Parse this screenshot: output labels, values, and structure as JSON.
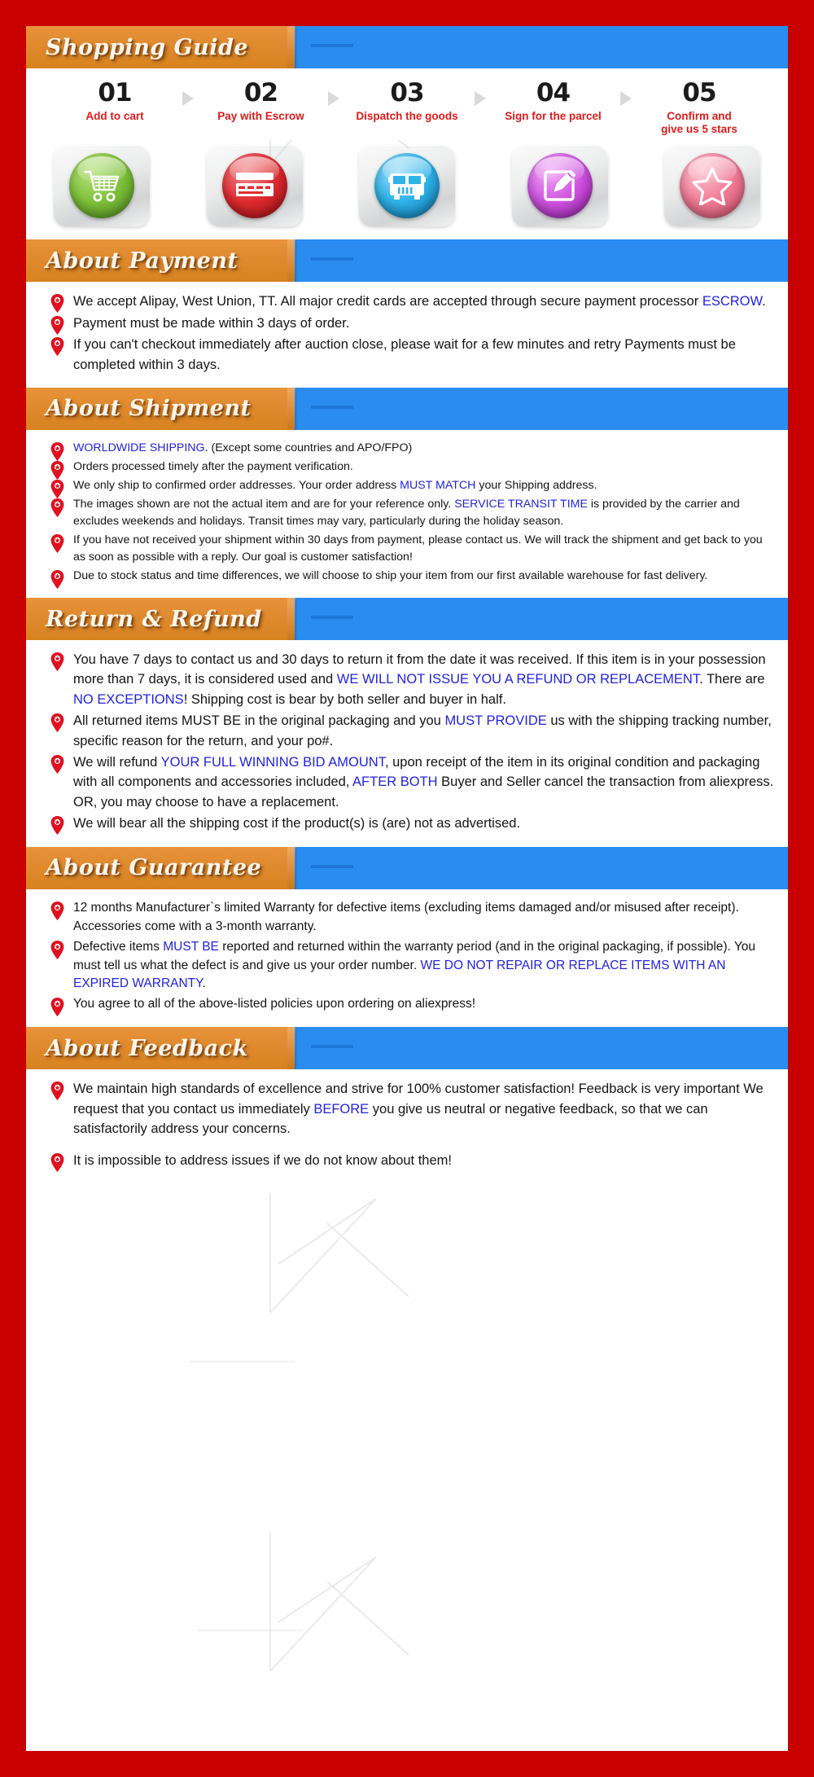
{
  "page": {
    "border_color": "#c80000",
    "accent_orange": "#df8a26",
    "accent_blue": "#2b8cf0",
    "link_color": "#2222dd",
    "step_label_color": "#e01a1a"
  },
  "shopping_guide": {
    "title": "Shopping Guide",
    "steps": [
      {
        "number": "01",
        "label": "Add to cart",
        "icon": "shopping-cart-icon",
        "color": "green"
      },
      {
        "number": "02",
        "label": "Pay with Escrow",
        "icon": "credit-card-icon",
        "color": "red"
      },
      {
        "number": "03",
        "label": "Dispatch the goods",
        "icon": "delivery-truck-icon",
        "color": "blue"
      },
      {
        "number": "04",
        "label": "Sign for the parcel",
        "icon": "sign-document-icon",
        "color": "purple"
      },
      {
        "number": "05",
        "label": "Confirm and\ngive us 5 stars",
        "label_line1": "Confirm and",
        "label_line2": "give us 5 stars",
        "icon": "star-rating-icon",
        "color": "pink"
      }
    ]
  },
  "about_payment": {
    "title": "About Payment",
    "points": [
      {
        "parts": [
          {
            "text": "We accept Alipay, West Union, TT. All major credit cards are accepted through secure payment processor ",
            "link": false
          },
          {
            "text": "ESCROW",
            "link": true
          },
          {
            "text": ".",
            "link": false
          }
        ]
      },
      {
        "parts": [
          {
            "text": "Payment must be made within 3 days of order.",
            "link": false
          }
        ]
      },
      {
        "parts": [
          {
            "text": "If you can't checkout immediately after auction close, please wait for a few minutes and retry Payments must be completed within 3 days.",
            "link": false
          }
        ]
      }
    ]
  },
  "about_shipment": {
    "title": "About Shipment",
    "points": [
      {
        "parts": [
          {
            "text": "WORLDWIDE SHIPPING",
            "link": true
          },
          {
            "text": ". (Except some countries and APO/FPO)",
            "link": false
          }
        ]
      },
      {
        "parts": [
          {
            "text": "Orders processed timely after the payment verification.",
            "link": false
          }
        ]
      },
      {
        "parts": [
          {
            "text": "We only ship to confirmed order addresses. Your order address ",
            "link": false
          },
          {
            "text": "MUST MATCH",
            "link": true
          },
          {
            "text": " your Shipping address.",
            "link": false
          }
        ]
      },
      {
        "parts": [
          {
            "text": "The images shown are not the actual item and are for your reference only. ",
            "link": false
          },
          {
            "text": "SERVICE TRANSIT TIME",
            "link": true
          },
          {
            "text": " is provided by the carrier and excludes weekends and holidays. Transit times may vary, particularly during the holiday season.",
            "link": false
          }
        ]
      },
      {
        "parts": [
          {
            "text": "If you have not received your shipment within 30 days from payment, please contact us. We will track the shipment and get back to you as soon as possible with a reply. Our goal is customer satisfaction!",
            "link": false
          }
        ]
      },
      {
        "parts": [
          {
            "text": "Due to stock status and time differences, we will choose to ship your item from our first available warehouse for fast delivery.",
            "link": false
          }
        ]
      }
    ]
  },
  "return_refund": {
    "title": "Return & Refund",
    "points": [
      {
        "parts": [
          {
            "text": "You have 7 days to contact us and 30 days to return it from the date it was received. If this item is in your possession more than 7 days, it is considered used and ",
            "link": false
          },
          {
            "text": "WE WILL NOT ISSUE YOU A REFUND OR REPLACEMENT",
            "link": true
          },
          {
            "text": ". There are ",
            "link": false
          },
          {
            "text": "NO EXCEPTIONS",
            "link": true
          },
          {
            "text": "! Shipping cost is bear by both seller and buyer in half.",
            "link": false
          }
        ]
      },
      {
        "parts": [
          {
            "text": "All returned items MUST BE in the original packaging and you ",
            "link": false
          },
          {
            "text": "MUST PROVIDE",
            "link": true
          },
          {
            "text": " us with the shipping tracking number, specific reason for the  return, and your po#.",
            "link": false
          }
        ]
      },
      {
        "parts": [
          {
            "text": "We will refund ",
            "link": false
          },
          {
            "text": "YOUR FULL WINNING BID AMOUNT",
            "link": true
          },
          {
            "text": ", upon receipt of the item in its original condition and packaging with all components and accessories included, ",
            "link": false
          },
          {
            "text": "AFTER BOTH",
            "link": true
          },
          {
            "text": " Buyer and Seller cancel the transaction from aliexpress. OR, you may choose to have a replacement.",
            "link": false
          }
        ]
      },
      {
        "parts": [
          {
            "text": "We will bear all the shipping cost if the product(s) is (are) not as advertised.",
            "link": false
          }
        ]
      }
    ]
  },
  "about_guarantee": {
    "title": "About Guarantee",
    "points": [
      {
        "parts": [
          {
            "text": "12 months Manufacturer`s limited Warranty for defective items (excluding  items damaged and/or misused after receipt). Accessories come with a 3-month warranty.",
            "link": false
          }
        ]
      },
      {
        "parts": [
          {
            "text": "Defective items ",
            "link": false
          },
          {
            "text": "MUST BE",
            "link": true
          },
          {
            "text": " reported and returned within the warranty period (and in the original packaging, if possible). You must tell us what the defect is and give us your order number. ",
            "link": false
          },
          {
            "text": "WE DO NOT REPAIR OR REPLACE ITEMS WITH AN EXPIRED WARRANTY",
            "link": true
          },
          {
            "text": ".",
            "link": false
          }
        ]
      },
      {
        "parts": [
          {
            "text": "You agree to all of the above-listed policies upon ordering on aliexpress!",
            "link": false
          }
        ]
      }
    ]
  },
  "about_feedback": {
    "title": "About Feedback",
    "points": [
      {
        "parts": [
          {
            "text": "We maintain high standards of excellence and strive for 100% customer satisfaction! Feedback is very important We request that you contact us immediately ",
            "link": false
          },
          {
            "text": "BEFORE",
            "link": true
          },
          {
            "text": " you give us neutral or negative feedback, so that we can satisfactorily address your concerns.",
            "link": false
          }
        ]
      },
      {
        "parts": [
          {
            "text": "It is impossible to address issues if we do not know about them!",
            "link": false
          }
        ]
      }
    ]
  }
}
